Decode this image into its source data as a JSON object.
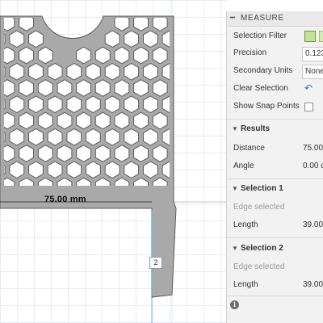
{
  "viewport": {
    "dimension_label": "75.00 mm",
    "selection_badge": "2"
  },
  "panel": {
    "title": "MEASURE",
    "selection_filter_label": "Selection Filter",
    "precision_label": "Precision",
    "precision_value": "0.123",
    "secondary_units_label": "Secondary Units",
    "secondary_units_value": "None",
    "clear_selection_label": "Clear Selection",
    "show_snap_points_label": "Show Snap Points",
    "results": {
      "header": "Results",
      "distance_label": "Distance",
      "distance_value": "75.00",
      "angle_label": "Angle",
      "angle_value": "0.00 d"
    },
    "selection1": {
      "header": "Selection 1",
      "status": "Edge selected",
      "length_label": "Length",
      "length_value": "39.00"
    },
    "selection2": {
      "header": "Selection 2",
      "status": "Edge selected",
      "length_label": "Length",
      "length_value": "39.00"
    },
    "info_icon": "i"
  },
  "icons": {
    "collapse": "minus-icon",
    "section_toggle": "triangle-down-icon",
    "clear": "undo-arrow-icon",
    "filter_a": "face-filter-icon",
    "filter_b": "body-filter-icon",
    "info": "info-icon"
  },
  "colors": {
    "part_fill": "#a9a9a9",
    "part_edge": "#5b5b5b",
    "selection_edge": "#6ab0e8",
    "grid": "#e7ebf0",
    "panel_bg": "#f2f2f2"
  }
}
